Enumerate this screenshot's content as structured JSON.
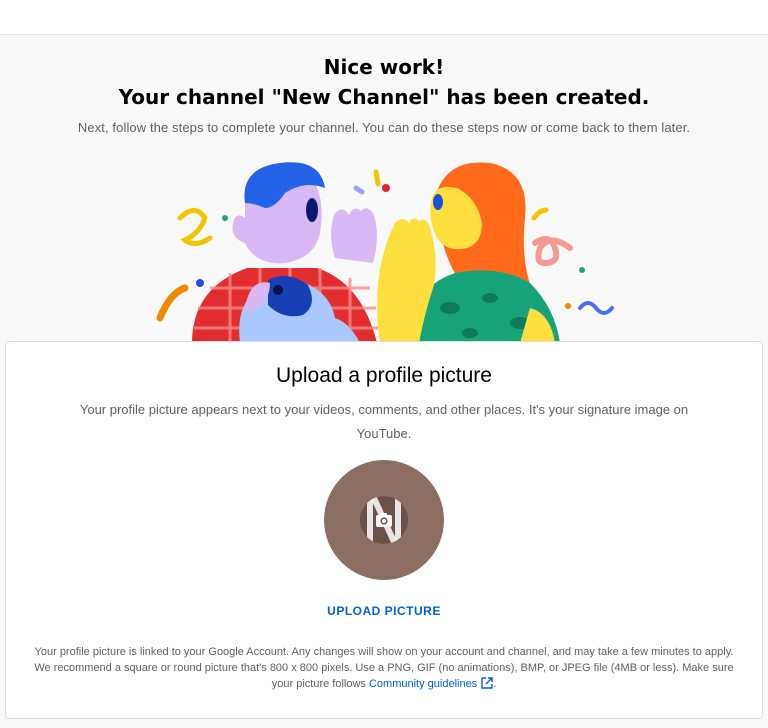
{
  "heading": {
    "line1": "Nice work!",
    "line2": "Your channel \"New Channel\" has been created."
  },
  "subtitle": "Next, follow the steps to complete your channel. You can do these steps now or come back to them later.",
  "profile_card": {
    "title": "Upload a profile picture",
    "description": "Your profile picture appears next to your videos, comments, and other places. It's your signature image on YouTube.",
    "avatar_icon": "camera-icon",
    "upload_button": "UPLOAD PICTURE",
    "footnote": "Your profile picture is linked to your Google Account. Any changes will show on your account and channel, and may take a few minutes to apply. We recommend a square or round picture that's 800 x 800 pixels. Use a PNG, GIF (no animations), BMP, or JPEG file (4MB or less). Make sure your picture follows",
    "guidelines_link": "Community guidelines",
    "link_icon": "external-link-icon"
  },
  "colors": {
    "link_blue": "#065fd4",
    "avatar_brown": "#8c6f62"
  }
}
